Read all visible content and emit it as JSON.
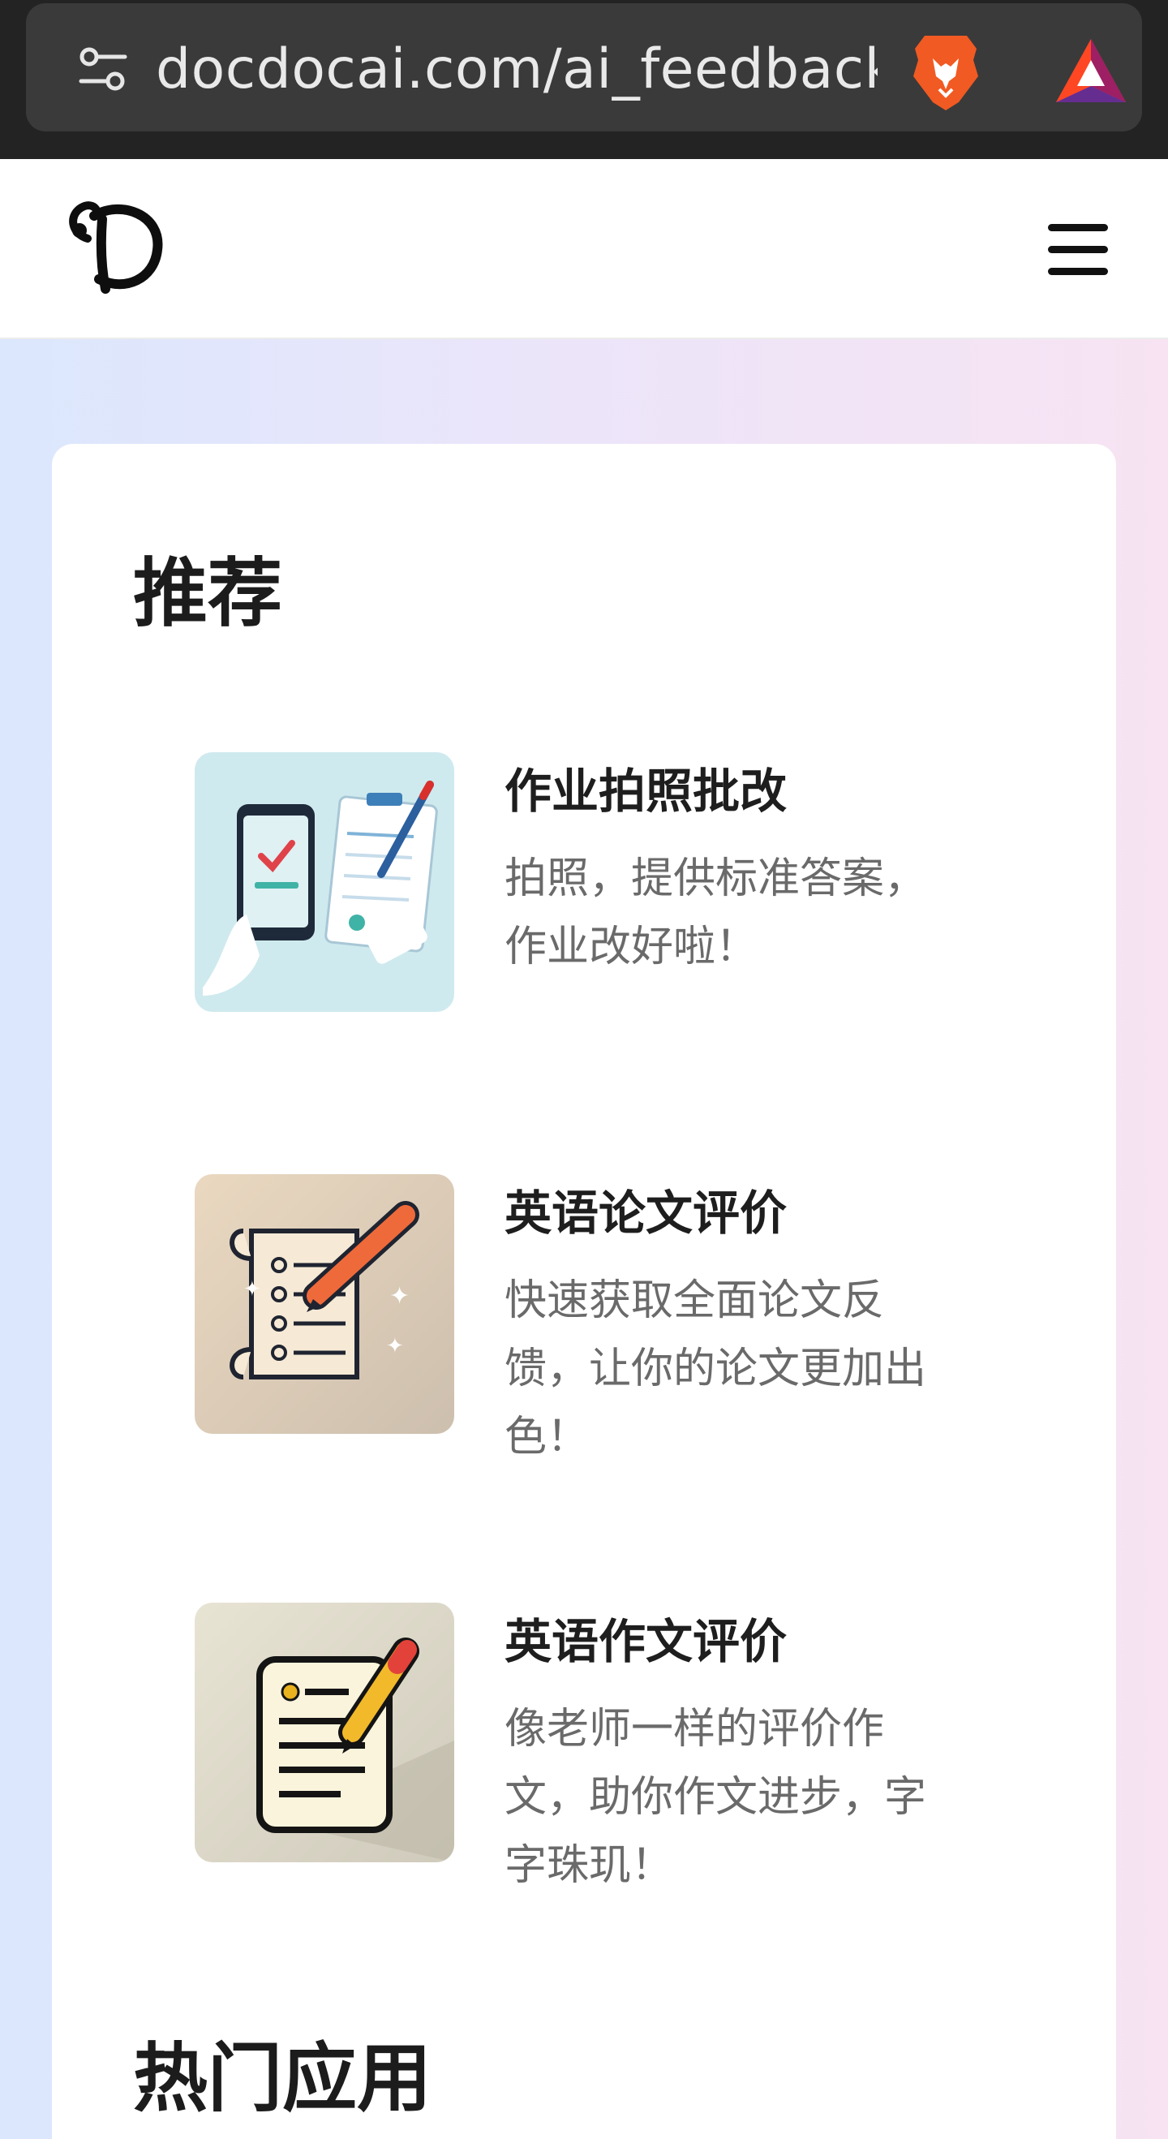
{
  "browser": {
    "url": "docdocai.com/ai_feedback/",
    "icons": [
      "tune-icon",
      "brave-lion-icon",
      "bat-rewards-icon"
    ]
  },
  "header": {
    "logo_icon": "site-logo-d",
    "menu_icon": "hamburger-menu-icon"
  },
  "sections": {
    "recommend": {
      "title": "推荐",
      "items": [
        {
          "title": "作业拍照批改",
          "description": "拍照，提供标准答案，作业改好啦！",
          "icon": "phone-test-paper-icon"
        },
        {
          "title": "英语论文评价",
          "description": "快速获取全面论文反馈，让你的论文更加出色！",
          "icon": "scroll-pencil-icon"
        },
        {
          "title": "英语作文评价",
          "description": "像老师一样的评价作文，助你作文进步，字字珠玑！",
          "icon": "notepad-pencil-icon"
        }
      ]
    },
    "hot": {
      "title": "热门应用"
    }
  },
  "colors": {
    "browser_bg": "#232323",
    "url_pill": "#3a3a3a",
    "page_gradient_left": "#dbe7fd",
    "page_gradient_right": "#f7e3f2",
    "title_text": "#1c1c1c",
    "desc_text": "#6a6a6a"
  }
}
